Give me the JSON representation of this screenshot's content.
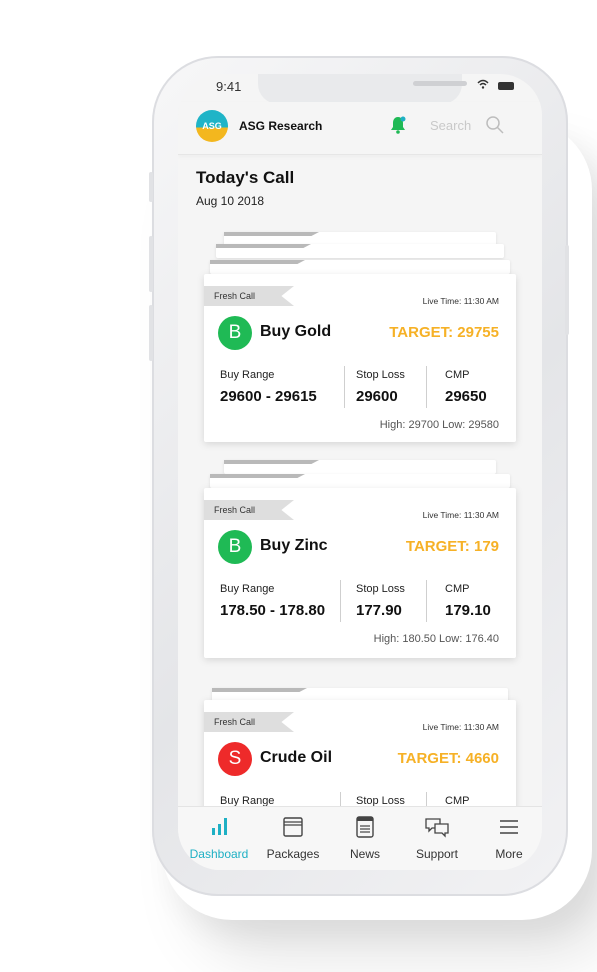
{
  "status": {
    "time": "9:41"
  },
  "header": {
    "logo_text": "ASG",
    "brand": "ASG Research",
    "search_placeholder": "Search"
  },
  "page": {
    "title": "Today's Call",
    "date": "Aug 10 2018"
  },
  "calls": [
    {
      "tag": "Fresh Call",
      "live_time": "Live Time: 11:30 AM",
      "badge": "B",
      "badge_color": "#1fba55",
      "name": "Buy Gold",
      "target": "TARGET: 29755",
      "range_label": "Buy Range",
      "range_value": "29600 - 29615",
      "stop_label": "Stop Loss",
      "stop_value": "29600",
      "cmp_label": "CMP",
      "cmp_value": "29650",
      "high_low": "High: 29700  Low: 29580"
    },
    {
      "tag": "Fresh Call",
      "live_time": "Live Time: 11:30 AM",
      "badge": "B",
      "badge_color": "#1fba55",
      "name": "Buy Zinc",
      "target": "TARGET: 179",
      "range_label": "Buy Range",
      "range_value": "178.50 - 178.80",
      "stop_label": "Stop Loss",
      "stop_value": "177.90",
      "cmp_label": "CMP",
      "cmp_value": "179.10",
      "high_low": "High: 180.50  Low: 176.40"
    },
    {
      "tag": "Fresh Call",
      "live_time": "Live Time: 11:30 AM",
      "badge": "S",
      "badge_color": "#ee2a2a",
      "name": "Crude Oil",
      "target": "TARGET: 4660",
      "range_label": "Buy Range",
      "stop_label": "Stop Loss",
      "cmp_label": "CMP"
    }
  ],
  "tabs": [
    {
      "label": "Dashboard",
      "icon": "bar-chart-icon",
      "active": true
    },
    {
      "label": "Packages",
      "icon": "package-icon"
    },
    {
      "label": "News",
      "icon": "news-icon"
    },
    {
      "label": "Support",
      "icon": "chat-icon"
    },
    {
      "label": "More",
      "icon": "menu-icon"
    }
  ],
  "colors": {
    "accent": "#1eb0c4",
    "target": "#f6b126",
    "buy": "#1fba55",
    "sell": "#ee2a2a"
  }
}
